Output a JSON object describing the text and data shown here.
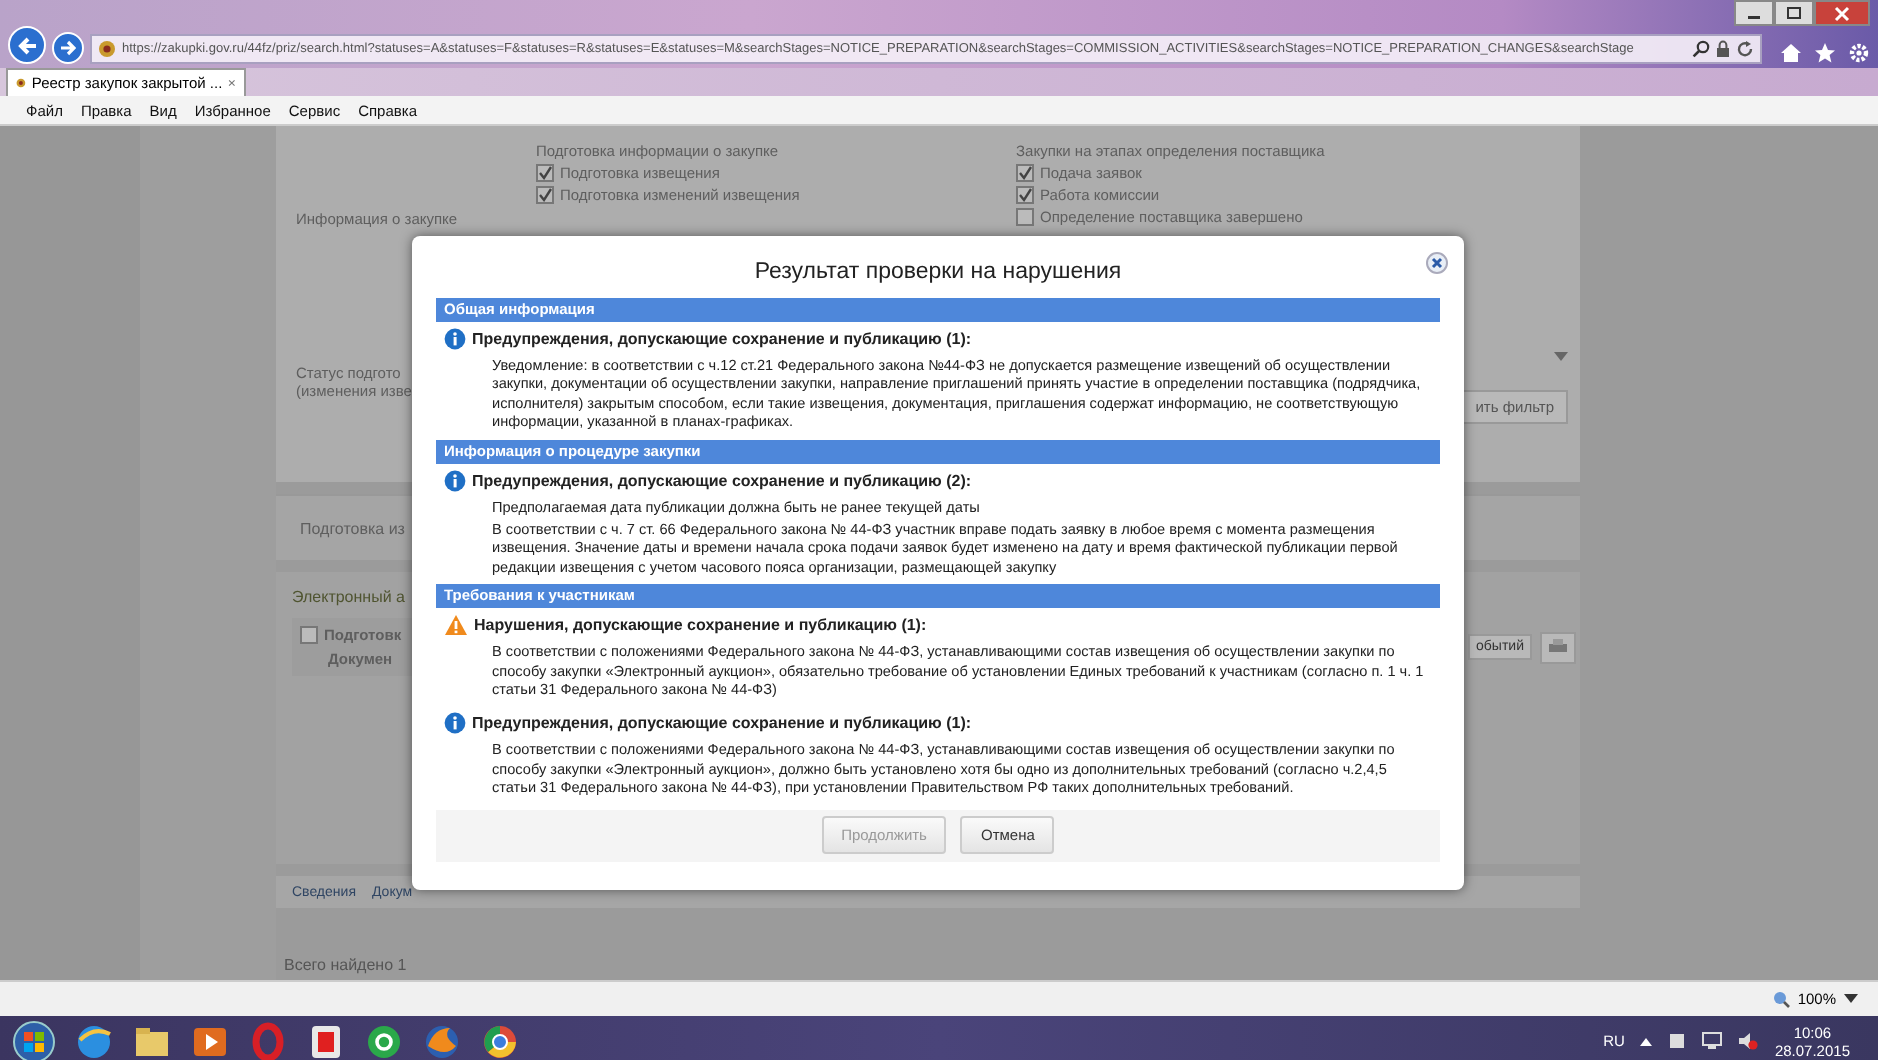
{
  "browser": {
    "url": "https://zakupki.gov.ru/44fz/priz/search.html?statuses=A&statuses=F&statuses=R&statuses=E&statuses=M&searchStages=NOTICE_PREPARATION&searchStages=COMMISSION_ACTIVITIES&searchStages=NOTICE_PREPARATION_CHANGES&searchStage",
    "tabs": [
      {
        "title": "Реестр закупок закрытой ...",
        "selected": true
      }
    ],
    "menu": [
      "Файл",
      "Правка",
      "Вид",
      "Избранное",
      "Сервис",
      "Справка"
    ]
  },
  "page": {
    "filter": {
      "info_label": "Информация о закупке",
      "groups": [
        {
          "title": "Подготовка информации о закупке",
          "options": [
            {
              "label": "Подготовка извещения",
              "checked": true
            },
            {
              "label": "Подготовка изменений извещения",
              "checked": true
            }
          ]
        },
        {
          "title": "Закупки на этапах определения поставщика",
          "options": [
            {
              "label": "Подача заявок",
              "checked": true
            },
            {
              "label": "Работа комиссии",
              "checked": true
            },
            {
              "label": "Определение поставщика завершено",
              "checked": false
            }
          ]
        }
      ],
      "status_label": [
        "Статус подгото",
        "(изменения изве"
      ],
      "apply_button": "ить фильтр"
    },
    "tab": "Подготовка из",
    "result": {
      "type": "Электронный а",
      "title": "Подготовк",
      "checked": false,
      "doc": "Докумен",
      "events_button": "обытий"
    },
    "bottom_tabs": [
      "Сведения",
      "Докум"
    ],
    "found": "Всего найдено 1"
  },
  "dialog": {
    "title": "Результат проверки на нарушения",
    "sections": [
      {
        "title": "Общая информация",
        "groups": [
          {
            "kind": "info",
            "heading": "Предупреждения, допускающие сохранение и публикацию (1):",
            "paragraphs": [
              "Уведомление: в соответствии с ч.12 ст.21 Федерального закона №44-ФЗ не допускается размещение извещений об осуществлении закупки, документации об осуществлении закупки, направление приглашений принять участие в определении поставщика (подрядчика, исполнителя) закрытым способом, если такие извещения, документация, приглашения содержат информацию, не соответствующую информации, указанной в планах-графиках."
            ]
          }
        ]
      },
      {
        "title": "Информация о процедуре закупки",
        "groups": [
          {
            "kind": "info",
            "heading": "Предупреждения, допускающие сохранение и публикацию (2):",
            "paragraphs": [
              "Предполагаемая дата публикации должна быть не ранее текущей даты",
              "В соответствии с ч. 7 ст. 66 Федерального закона № 44-ФЗ участник вправе подать заявку в любое время с момента размещения извещения. Значение даты и времени начала срока подачи заявок будет изменено на дату и время фактической публикации первой редакции извещения с учетом часового пояса организации, размещающей закупку"
            ]
          }
        ]
      },
      {
        "title": "Требования к участникам",
        "groups": [
          {
            "kind": "warning",
            "heading": "Нарушения, допускающие сохранение и публикацию (1):",
            "paragraphs": [
              "В соответствии с положениями Федерального закона № 44-ФЗ, устанавливающими состав извещения об осуществлении закупки по способу закупки «Электронный аукцион», обязательно требование об установлении Единых требований к участникам (согласно п. 1 ч. 1 статьи 31 Федерального закона № 44-ФЗ)"
            ]
          },
          {
            "kind": "info",
            "heading": "Предупреждения, допускающие сохранение и публикацию (1):",
            "paragraphs": [
              "В соответствии с положениями Федерального закона № 44-ФЗ, устанавливающими состав извещения об осуществлении закупки по способу закупки «Электронный аукцион», должно быть установлено хотя бы одно из дополнительных требований (согласно ч.2,4,5 статьи 31 Федерального закона № 44-ФЗ), при установлении Правительством РФ таких дополнительных требований."
            ]
          }
        ]
      }
    ],
    "buttons": [
      {
        "label": "Продолжить",
        "disabled": true
      },
      {
        "label": "Отмена",
        "disabled": false
      }
    ]
  },
  "status_bar": {
    "zoom": "100%"
  },
  "taskbar": {
    "apps": [
      {
        "kind": "ie"
      },
      {
        "kind": "folder"
      },
      {
        "kind": "media"
      },
      {
        "kind": "ring"
      },
      {
        "kind": "square"
      },
      {
        "kind": "at"
      },
      {
        "kind": "fox"
      },
      {
        "kind": "wheel"
      }
    ],
    "language": "RU",
    "time": "10:06",
    "date": "28.07.2015"
  }
}
